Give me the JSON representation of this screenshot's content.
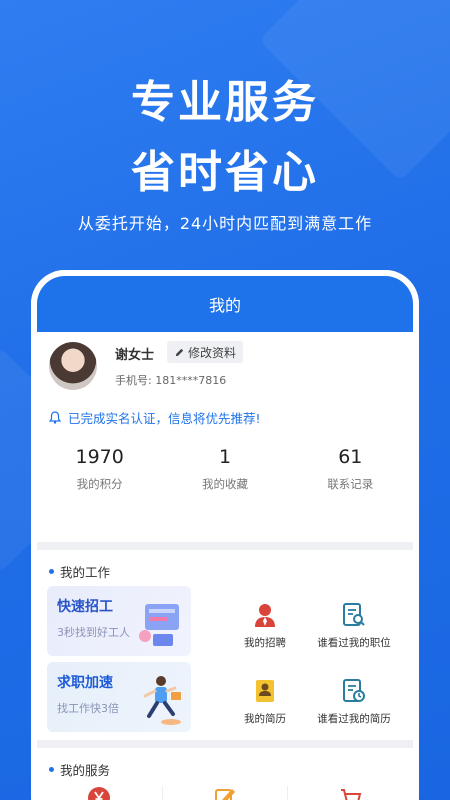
{
  "hero": {
    "title_line1": "专业服务",
    "title_line2": "省时省心",
    "subtitle": "从委托开始，24小时内匹配到满意工作"
  },
  "app": {
    "header_title": "我的",
    "profile": {
      "name": "谢女士",
      "edit_label": "修改资料",
      "phone_label": "手机号:",
      "phone_value": "181****7816",
      "notice": "已完成实名认证，信息将优先推荐!"
    },
    "stats": [
      {
        "value": "1970",
        "label": "我的积分"
      },
      {
        "value": "1",
        "label": "我的收藏"
      },
      {
        "value": "61",
        "label": "联系记录"
      }
    ],
    "work": {
      "title": "我的工作",
      "card_recruit": {
        "title": "快速招工",
        "subtitle": "3秒找到好工人"
      },
      "card_job": {
        "title": "求职加速",
        "subtitle": "找工作快3倍"
      },
      "items": [
        {
          "label": "我的招聘",
          "icon": "person-recruit-icon"
        },
        {
          "label": "谁看过我的职位",
          "icon": "document-search-icon"
        },
        {
          "label": "我的简历",
          "icon": "resume-icon"
        },
        {
          "label": "谁看过我的简历",
          "icon": "document-clock-icon"
        }
      ]
    },
    "services": {
      "title": "我的服务",
      "icons": [
        "yen-coin-icon",
        "edit-note-icon",
        "cart-icon"
      ]
    }
  },
  "colors": {
    "brand_blue": "#1f73ea",
    "background_blue": "#2072ea"
  }
}
